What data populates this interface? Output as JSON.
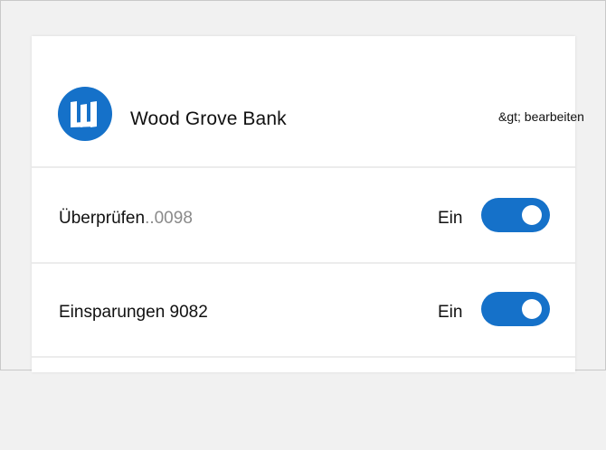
{
  "bank": {
    "name": "Wood Grove Bank",
    "edit_label": "&gt; bearbeiten",
    "logo_color": "#1571c9",
    "logo_icon": "bank-logo-icon"
  },
  "accounts": [
    {
      "label": "Überprüfen",
      "number": "..0098",
      "toggle_state": "Ein",
      "enabled": true
    },
    {
      "label": "Einsparungen 9082",
      "number": "",
      "toggle_state": "Ein",
      "enabled": true
    }
  ],
  "colors": {
    "accent": "#1571c9",
    "divider": "#ececec",
    "background": "#f1f1f1"
  }
}
